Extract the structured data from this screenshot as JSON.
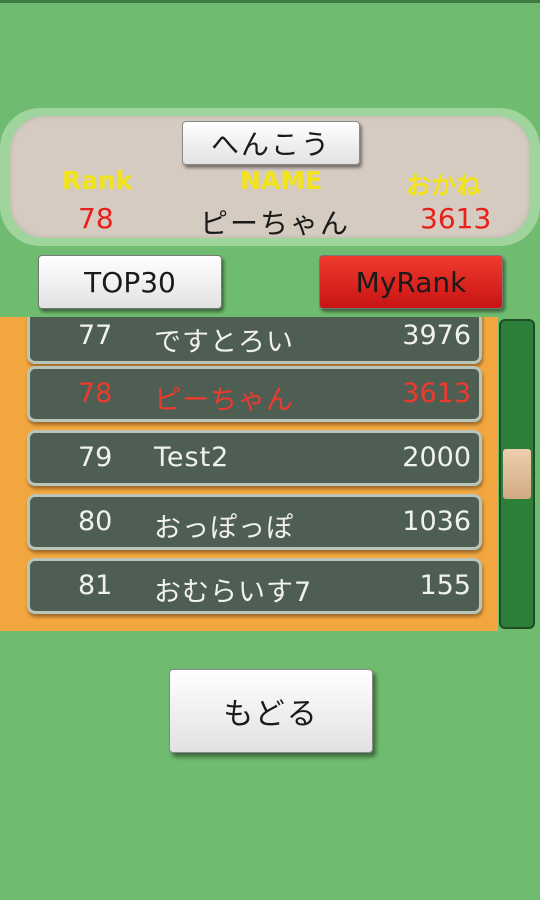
{
  "header": {
    "change_button": "へんこう",
    "rank_label": "Rank",
    "name_label": "NAME",
    "money_label": "おかね",
    "rank_value": "78",
    "name_value": "ピーちゃん",
    "money_value": "3613"
  },
  "tabs": {
    "top30": "TOP30",
    "myrank": "MyRank"
  },
  "ranking": [
    {
      "rank": "77",
      "name": "ですとろい",
      "money": "3976",
      "highlight": false
    },
    {
      "rank": "78",
      "name": "ピーちゃん",
      "money": "3613",
      "highlight": true
    },
    {
      "rank": "79",
      "name": "Test2",
      "money": "2000",
      "highlight": false
    },
    {
      "rank": "80",
      "name": "おっぽっぽ",
      "money": "1036",
      "highlight": false
    },
    {
      "rank": "81",
      "name": "おむらいす7",
      "money": "155",
      "highlight": false
    }
  ],
  "scrollbar": {
    "position": 0.5
  },
  "back_button": "もどる",
  "colors": {
    "background": "#6fbb6f",
    "list_background": "#f2a63f",
    "row_background": "#4f5e53",
    "highlight_text": "#ee3a2c",
    "label_yellow": "#f3e41a",
    "myrank_button": "#e01e1e"
  }
}
